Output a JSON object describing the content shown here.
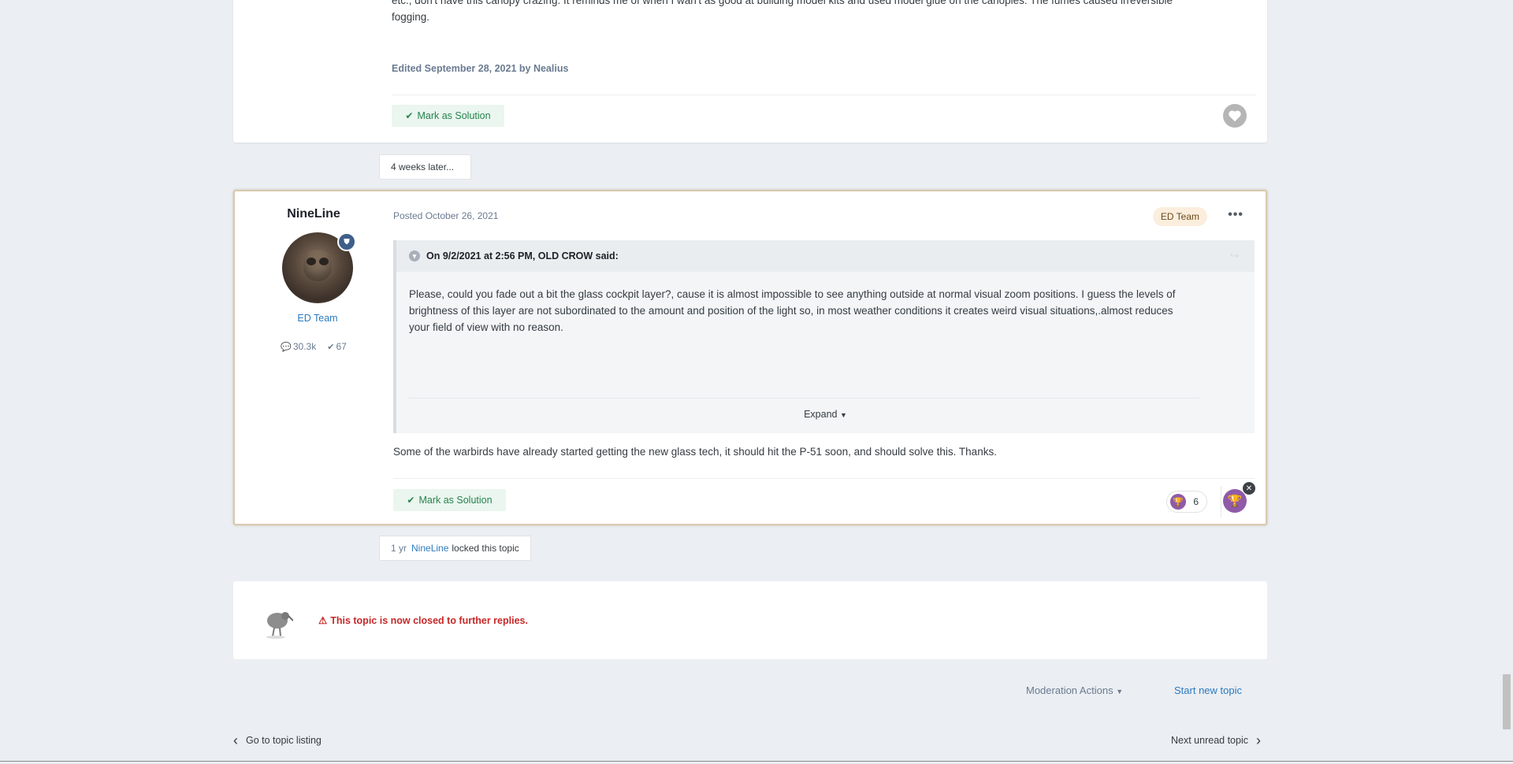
{
  "post1": {
    "body_lines": [
      "etc., don't have this canopy crazing. It reminds me of when I wan't as good at building model kits and used model glue on the canopies: The fumes caused irreversible",
      "fogging."
    ],
    "edited": "Edited September 28, 2021 by Nealius",
    "mark_solution": "Mark as Solution"
  },
  "time_gap": "4 weeks later...",
  "post2": {
    "author": "NineLine",
    "group": "ED Team",
    "stats": {
      "posts": "30.3k",
      "solutions": "67"
    },
    "posted": "Posted October 26, 2021",
    "team_badge": "ED Team",
    "quote": {
      "header": "On 9/2/2021 at 2:56 PM, OLD CROW said:",
      "body_lines": [
        "Please, could you fade out a bit the glass cockpit layer?, cause it is almost impossible to see anything outside at normal visual zoom positions. I guess the levels of",
        "brightness of this layer are not subordinated to the amount and position of the light so, in most weather conditions it creates weird visual situations,.almost reduces",
        "your field of view with no reason."
      ],
      "expand": "Expand"
    },
    "reply": "Some of the warbirds have already started getting the new glass tech, it should hit the P-51 soon, and should solve this. Thanks.",
    "mark_solution": "Mark as Solution",
    "reaction_count": "6"
  },
  "lock_event": {
    "ago": "1 yr",
    "user": "NineLine",
    "action": "locked this topic"
  },
  "closed": {
    "message": "This topic is now closed to further replies."
  },
  "footer": {
    "moderation": "Moderation Actions",
    "start_topic": "Start new topic",
    "prev": "Go to topic listing",
    "next": "Next unread topic"
  },
  "colors": {
    "accent_blue": "#2a7ac0",
    "success_green": "#27834f",
    "error_red": "#c62828",
    "reaction_purple": "#8f5aa8"
  }
}
